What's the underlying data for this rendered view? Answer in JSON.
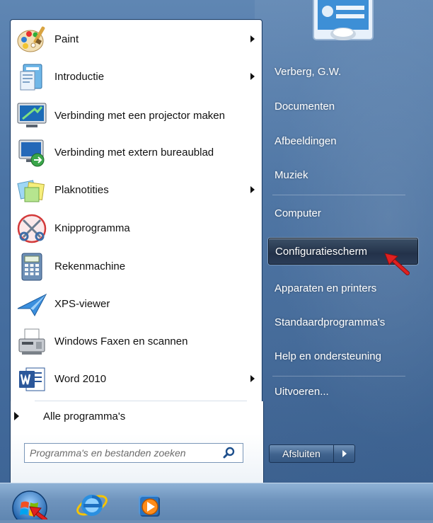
{
  "programs": [
    {
      "label": "Paint",
      "icon": "paint-icon",
      "has_submenu": true
    },
    {
      "label": "Introductie",
      "icon": "introductie-icon",
      "has_submenu": true
    },
    {
      "label": "Verbinding met een projector maken",
      "icon": "projector-icon",
      "has_submenu": false
    },
    {
      "label": "Verbinding met extern bureaublad",
      "icon": "remote-desktop-icon",
      "has_submenu": false
    },
    {
      "label": "Plaknotities",
      "icon": "sticky-notes-icon",
      "has_submenu": true
    },
    {
      "label": "Knipprogramma",
      "icon": "snipping-tool-icon",
      "has_submenu": false
    },
    {
      "label": "Rekenmachine",
      "icon": "calculator-icon",
      "has_submenu": false
    },
    {
      "label": "XPS-viewer",
      "icon": "xps-viewer-icon",
      "has_submenu": false
    },
    {
      "label": "Windows Faxen en scannen",
      "icon": "fax-scan-icon",
      "has_submenu": false
    },
    {
      "label": "Word 2010",
      "icon": "word-icon",
      "has_submenu": true
    }
  ],
  "all_programs_label": "Alle programma's",
  "search": {
    "placeholder": "Programma's en bestanden zoeken"
  },
  "right_items": [
    {
      "label": "Verberg, G.W."
    },
    {
      "label": "Documenten"
    },
    {
      "label": "Afbeeldingen"
    },
    {
      "label": "Muziek"
    },
    {
      "label": "Computer"
    },
    {
      "label": "Configuratiescherm",
      "highlighted": true
    },
    {
      "label": "Apparaten en printers"
    },
    {
      "label": "Standaardprogramma's"
    },
    {
      "label": "Help en ondersteuning"
    },
    {
      "label": "Uitvoeren..."
    }
  ],
  "shutdown": {
    "label": "Afsluiten"
  },
  "colors": {
    "highlight": "#23324a",
    "annotation_arrow": "#e02020",
    "menu_glass": "#4a73a4"
  }
}
